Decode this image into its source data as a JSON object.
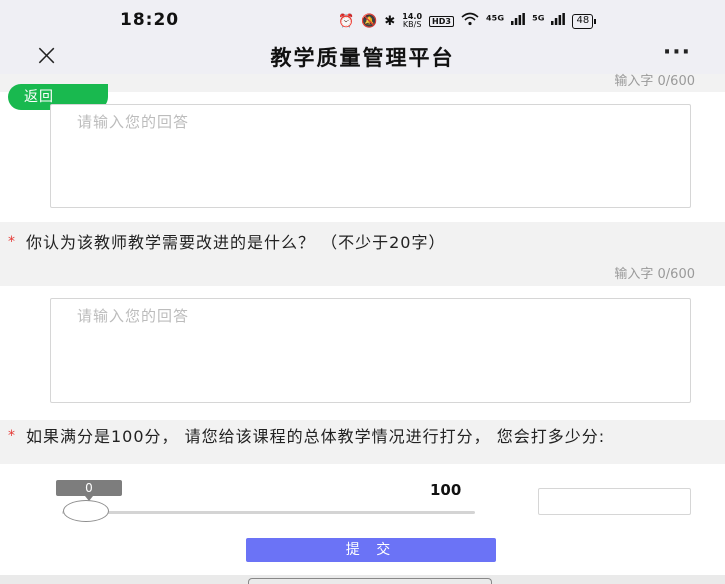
{
  "status_bar": {
    "time": "18:20",
    "icons": [
      "alarm-icon",
      "mute-icon",
      "bluetooth-icon",
      "network-speed",
      "hd-icon",
      "wifi-icon",
      "signal-5g-icon",
      "signal-5g-icon-2",
      "battery-icon"
    ],
    "net_speed": "14.0",
    "net_unit": "KB/S",
    "hd_label": "HD3",
    "signal1": "⁴⁵ᴳ",
    "signal2": "⁵ᴳ",
    "battery": "48"
  },
  "nav": {
    "close_icon": "×",
    "title": "教学质量管理平台",
    "more_icon": "···"
  },
  "back_button": "返回",
  "answer1": {
    "counter": "输入字 0/600",
    "placeholder": "请输入您的回答"
  },
  "question2": {
    "required_mark": "*",
    "text": "你认为该教师教学需要改进的是什么？  （不少于20字）",
    "counter": "输入字 0/600",
    "placeholder": "请输入您的回答"
  },
  "question3": {
    "required_mark": "*",
    "text": "如果满分是100分， 请您给该课程的总体教学情况进行打分， 您会打多少分:",
    "slider_value": "0",
    "slider_max": "100",
    "slider_fraction": 0
  },
  "submit_label": "提 交",
  "colors": {
    "back_green": "#19b94f",
    "submit_blue": "#6b73f6",
    "required_red": "#e53935"
  }
}
